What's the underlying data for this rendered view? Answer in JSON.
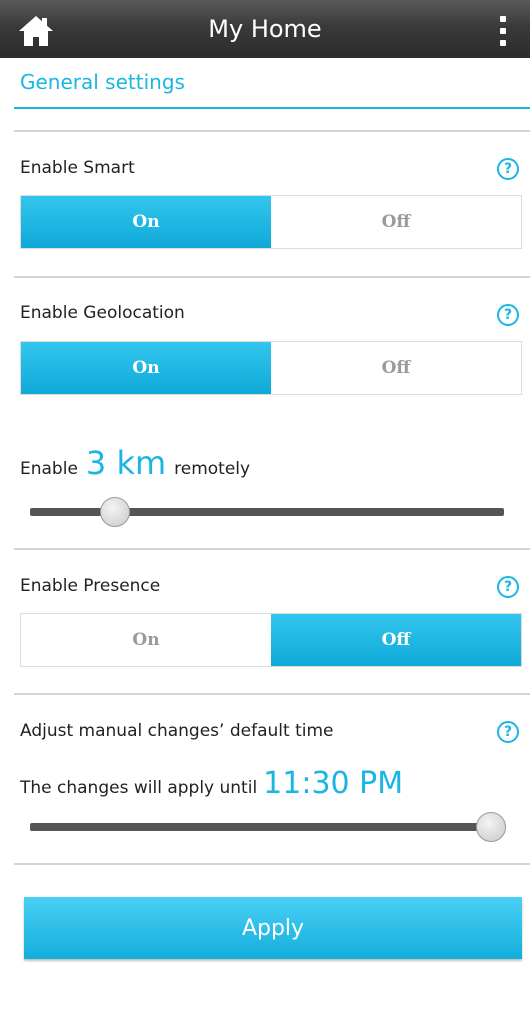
{
  "header": {
    "title": "My Home",
    "home_icon": "home-icon",
    "menu_icon": "more-vertical-icon"
  },
  "page": {
    "section_title": "General settings"
  },
  "smart": {
    "label": "Enable Smart",
    "on": "On",
    "off": "Off",
    "selected": "On"
  },
  "geolocation": {
    "label": "Enable Geolocation",
    "on": "On",
    "off": "Off",
    "selected": "On"
  },
  "distance": {
    "prefix": "Enable",
    "value": "3 km",
    "suffix": "remotely",
    "slider_level": 0.16
  },
  "presence": {
    "label": "Enable Presence",
    "on": "On",
    "off": "Off",
    "selected": "Off"
  },
  "manual": {
    "label": "Adjust manual changes’ default time",
    "apply_text": "The changes will apply until",
    "time": "11:30 PM",
    "slider_level": 1.0
  },
  "help_icon_text": "?",
  "apply_label": "Apply",
  "colors": {
    "accent": "#19b6e3",
    "header": "#3a3a3a"
  }
}
